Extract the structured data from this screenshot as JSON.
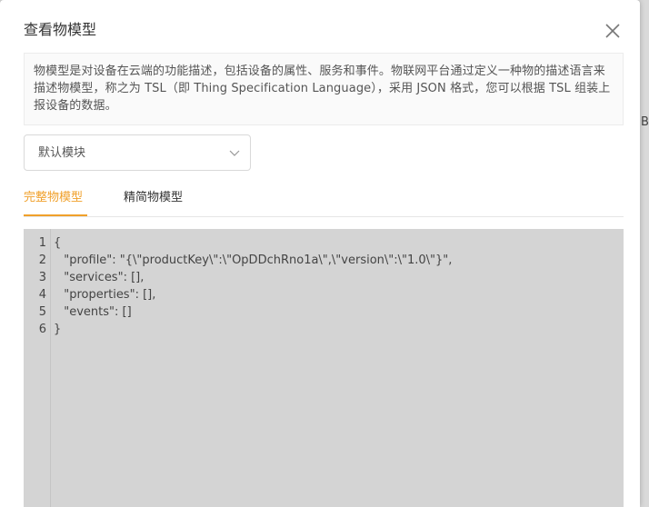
{
  "dialog": {
    "title": "查看物模型",
    "close_icon": "close-icon"
  },
  "notice": {
    "text": "物模型是对设备在云端的功能描述，包括设备的属性、服务和事件。物联网平台通过定义一种物的描述语言来描述物模型，称之为 TSL（即 Thing Specification Language），采用 JSON 格式，您可以根据 TSL 组装上报设备的数据。"
  },
  "module_select": {
    "value": "默认模块",
    "arrow_icon": "chevron-down-icon"
  },
  "tabs": [
    {
      "label": "完整物模型",
      "active": true
    },
    {
      "label": "精简物模型",
      "active": false
    }
  ],
  "colors": {
    "accent": "#f0a02a",
    "code_bg": "#d4d4d4"
  },
  "code": {
    "lines": [
      {
        "num": "1",
        "text": "{"
      },
      {
        "num": "2",
        "text": "  \"profile\": \"{\\\"productKey\\\":\\\"OpDDchRno1a\\\",\\\"version\\\":\\\"1.0\\\"}\","
      },
      {
        "num": "3",
        "text": "  \"services\": [],"
      },
      {
        "num": "4",
        "text": "  \"properties\": [],"
      },
      {
        "num": "5",
        "text": "  \"events\": []"
      },
      {
        "num": "6",
        "text": "}"
      }
    ]
  },
  "background": {
    "edge_letter": "B"
  }
}
